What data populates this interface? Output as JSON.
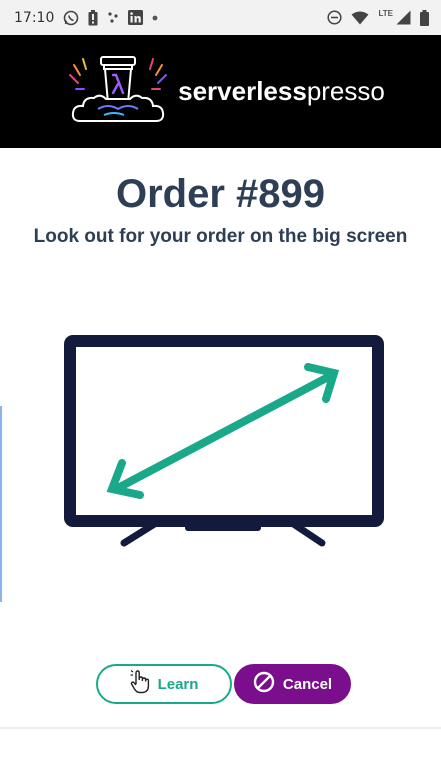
{
  "status_bar": {
    "time": "17:10",
    "left_icons": [
      "whatsapp-icon",
      "battery-alert-icon",
      "dots-icon",
      "linkedin-icon",
      "dot-icon"
    ],
    "right_icons": [
      "do-not-disturb-icon",
      "wifi-icon",
      "signal-icon",
      "battery-icon"
    ],
    "network_label": "LTE"
  },
  "header": {
    "brand_bold": "serverless",
    "brand_light": "presso",
    "logo_icon": "coffee-cup-cloud-icon",
    "background_color": "#000000"
  },
  "order": {
    "title": "Order #899",
    "subtitle": "Look out for your order on the big screen"
  },
  "illustration": {
    "icon": "big-screen-tv-icon",
    "frame_color": "#141a3c",
    "arrow_color": "#1aa88a"
  },
  "actions": {
    "learn_label": "Learn",
    "cancel_label": "Cancel",
    "learn_icon": "hand-pointer-icon",
    "cancel_icon": "cancel-icon",
    "learn_color": "#1aa88a",
    "cancel_color": "#7a0e8c"
  }
}
